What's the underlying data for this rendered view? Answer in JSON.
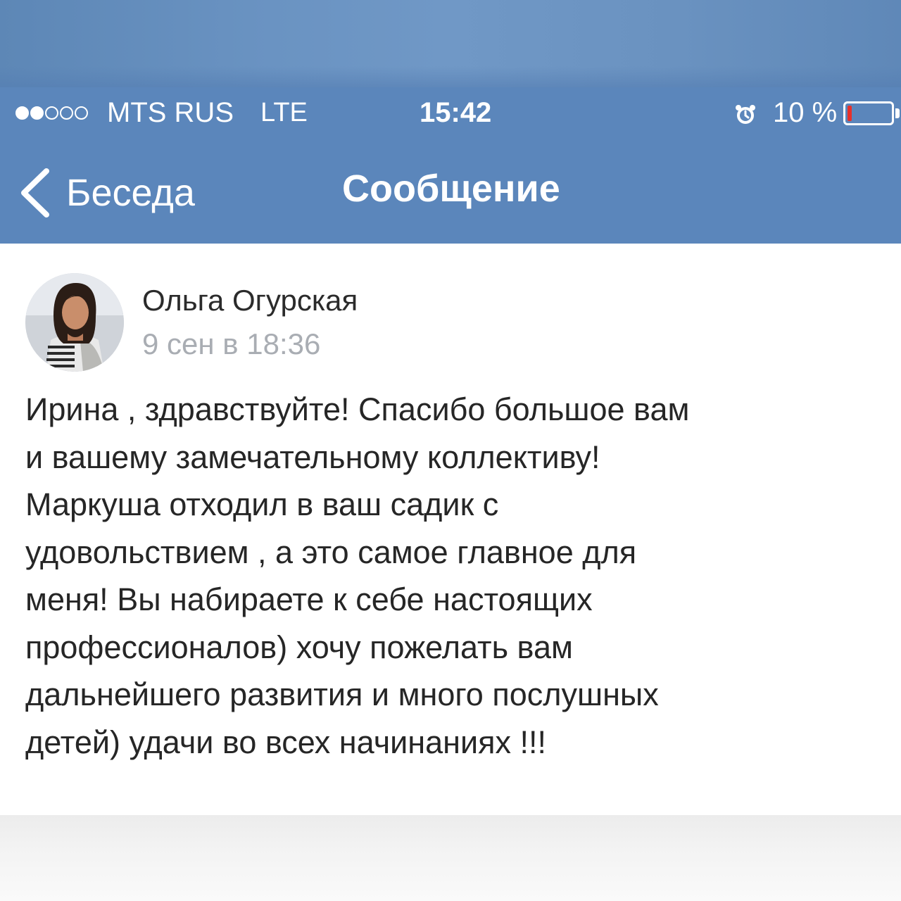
{
  "status_bar": {
    "signal_filled": 2,
    "signal_total": 5,
    "carrier": "MTS RUS",
    "network": "LTE",
    "time": "15:42",
    "alarm_icon": "alarm-clock-icon",
    "battery_percent_text": "10 %",
    "battery_level": 0.1,
    "battery_color": "#e8302a"
  },
  "nav": {
    "back_label": "Беседа",
    "title": "Сообщение",
    "bar_color": "#5b86bb"
  },
  "message": {
    "author": "Ольга Огурская",
    "timestamp": "9 сен в 18:36",
    "text": "Ирина , здравствуйте! Спасибо большое вам\nи вашему замечательному коллективу!\nМаркуша отходил в ваш садик с\nудовольствием , а это самое главное для\nменя! Вы набираете к себе настоящих\nпрофессионалов) хочу пожелать вам\nдальнейшего развития и много послушных\nдетей) удачи во всех начинаниях !!!"
  }
}
